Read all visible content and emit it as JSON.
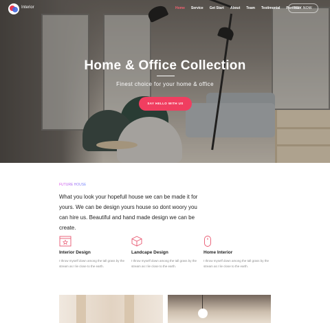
{
  "brand": {
    "name": "Interior"
  },
  "nav": {
    "items": [
      {
        "label": "Home",
        "active": true
      },
      {
        "label": "Service",
        "active": false
      },
      {
        "label": "Get Start",
        "active": false
      },
      {
        "label": "About",
        "active": false
      },
      {
        "label": "Team",
        "active": false
      },
      {
        "label": "Testimonial",
        "active": false
      },
      {
        "label": "Portfolio",
        "active": false
      }
    ],
    "buy_label": "BUY NOW"
  },
  "hero": {
    "title": "Home & Office Collection",
    "subtitle": "Finest choice for your home & office",
    "cta_label": "SAY HELLO WITH US"
  },
  "about": {
    "eyebrow": "FUTURE HOUSE",
    "lead": "What you look your hopefull house we can be made it for yours. We can be design yours house so dont woory you can hire us. Beautiful and hand made design we can be create."
  },
  "features": [
    {
      "icon": "window-frame-icon",
      "title": "Interior Design",
      "text": "I throw myself down among the tall grass by the stream as I lie close to the earth."
    },
    {
      "icon": "cube-icon",
      "title": "Landcape Design",
      "text": "I throw myself down among the tall grass by the stream as I lie close to the earth."
    },
    {
      "icon": "mouse-icon",
      "title": "Home Interior",
      "text": "I throw myself down among the tall grass by the stream as I lie close to the earth."
    }
  ],
  "colors": {
    "accent": "#f03e60",
    "nav_active": "#f26272",
    "icon": "#e8566f"
  }
}
